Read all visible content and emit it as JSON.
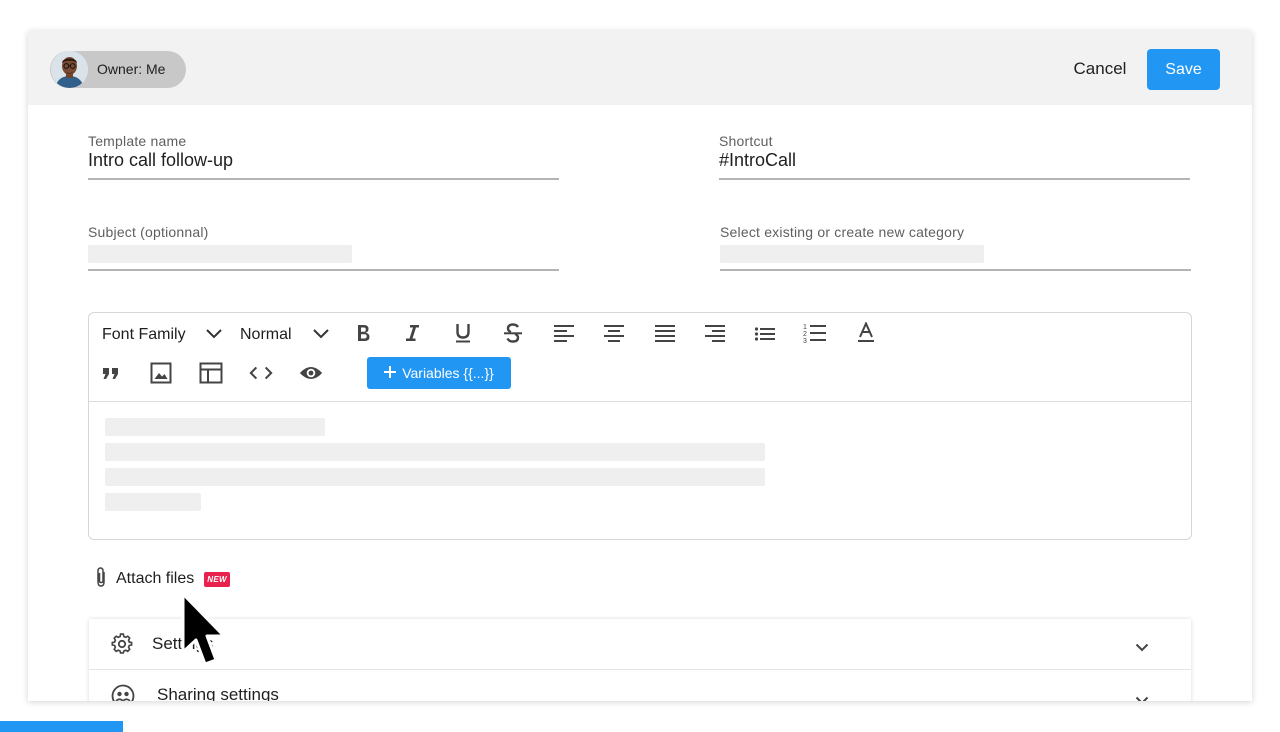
{
  "header": {
    "owner_chip_label": "Owner: Me",
    "cancel_label": "Cancel",
    "save_label": "Save"
  },
  "form": {
    "template_name": {
      "label": "Template name",
      "value": "Intro call follow-up"
    },
    "shortcut": {
      "label": "Shortcut",
      "value": "#IntroCall"
    },
    "subject": {
      "label": "Subject (optionnal)",
      "value": ""
    },
    "category": {
      "label": "Select existing or create new category",
      "value": ""
    }
  },
  "toolbar": {
    "font_family_label": "Font Family",
    "font_size_label": "Normal",
    "variables_label": "Variables {{...}}",
    "icons": [
      "chevron-down-icon",
      "bold-icon",
      "italic-icon",
      "underline-icon",
      "strikethrough-icon",
      "align-left-icon",
      "align-center-icon",
      "align-justify-icon",
      "align-right-icon",
      "bullet-list-icon",
      "numbered-list-icon",
      "text-color-icon",
      "quote-icon",
      "image-icon",
      "table-icon",
      "code-icon",
      "preview-eye-icon",
      "plus-icon"
    ]
  },
  "attachments": {
    "label": "Attach files",
    "badge": "NEW"
  },
  "settings": {
    "rows": [
      {
        "label": "Settings",
        "icon": "gear-icon"
      },
      {
        "label": "Sharing settings",
        "icon": "sharing-icon"
      }
    ]
  },
  "colors": {
    "accent": "#2196f3",
    "badge": "#e8214f",
    "header_bg": "#f2f2f2",
    "chip_bg": "#c8c8c8"
  }
}
